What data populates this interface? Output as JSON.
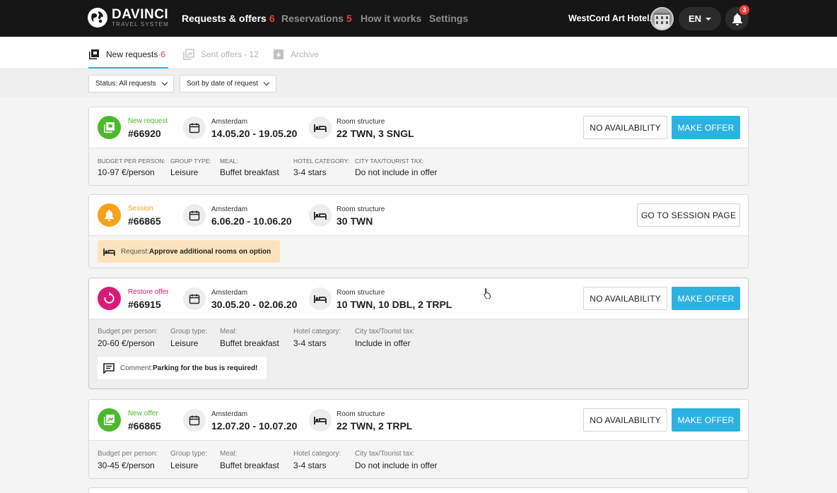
{
  "brand": {
    "title": "DAVINCI",
    "subtitle": "TRAVEL SYSTEM"
  },
  "nav": {
    "requests_label": "Requests & offers",
    "requests_count": "6",
    "reservations_label": "Reservations",
    "reservations_count": "5",
    "how_label": "How it works",
    "settings_label": "Settings"
  },
  "header": {
    "hotel": "WestCord Art Hotel...",
    "lang": "EN",
    "notifications": "3"
  },
  "tabs": {
    "new_label": "New requests",
    "new_sep": " - ",
    "new_count": "6",
    "sent_label": "Sent offers - 12",
    "archive_label": "Archive"
  },
  "filters": {
    "status": "Status: All requests",
    "sort": "Sort by date of request"
  },
  "colors": {
    "accent": "#2cb2e2",
    "new": "#4cb82b",
    "session": "#f8a21e",
    "restore": "#d81a78",
    "badge": "#ef3b3b"
  },
  "cards": [
    {
      "status": "New request",
      "id": "#66920",
      "city": "Amsterdam",
      "dates": "14.05.20 - 19.05.20",
      "room_label": "Room structure",
      "rooms": "22 TWN, 3 SNGL",
      "btn1": "NO AVAILABILITY",
      "btn2": "MAKE OFFER",
      "info": [
        {
          "label": "BUDGET PER PERSON:",
          "value": "10-97 €/person"
        },
        {
          "label": "GROUP TYPE:",
          "value": "Leisure"
        },
        {
          "label": "MEAL:",
          "value": "Buffet breakfast"
        },
        {
          "label": "HOTEL CATEGORY:",
          "value": "3-4 stars"
        },
        {
          "label": "CITY TAX/TOURIST TAX:",
          "value": "Do not include in offer"
        }
      ]
    },
    {
      "status": "Session",
      "id": "#66865",
      "city": "Amsterdam",
      "dates": "6.06.20 - 10.06.20",
      "room_label": "Room structure",
      "rooms": "30 TWN",
      "btn1": "GO TO SESSION PAGE",
      "note_key": "Request: ",
      "note_val": "Approve additional rooms on option"
    },
    {
      "status": "Restore offer",
      "id": "#66915",
      "city": "Amsterdam",
      "dates": "30.05.20 - 02.06.20",
      "room_label": "Room structure",
      "rooms": "10 TWN, 10 DBL, 2 TRPL",
      "btn1": "NO AVAILABILITY",
      "btn2": "MAKE OFFER",
      "info": [
        {
          "label": "Budget per person:",
          "value": "20-60 €/person"
        },
        {
          "label": "Group type:",
          "value": "Leisure"
        },
        {
          "label": "Meal:",
          "value": "Buffet breakfast"
        },
        {
          "label": "Hotel category:",
          "value": "3-4 stars"
        },
        {
          "label": "City tax/Tourist tax:",
          "value": "Include in offer"
        }
      ],
      "note_key": "Comment: ",
      "note_val": "Parking for the bus is required!"
    },
    {
      "status": "New offer",
      "id": "#66865",
      "city": "Amsterdam",
      "dates": "12.07.20 - 10.07.20",
      "room_label": "Room structure",
      "rooms": "22 TWN, 2 TRPL",
      "btn1": "NO AVAILABILITY",
      "btn2": "MAKE OFFER",
      "info": [
        {
          "label": "Budget per person:",
          "value": "30-45 €/person"
        },
        {
          "label": "Group type:",
          "value": "Leisure"
        },
        {
          "label": "Meal:",
          "value": "Buffet breakfast"
        },
        {
          "label": "Hotel category:",
          "value": "3-4 stars"
        },
        {
          "label": "City tax/Tourist tax:",
          "value": "Do not include in offer"
        }
      ]
    }
  ]
}
